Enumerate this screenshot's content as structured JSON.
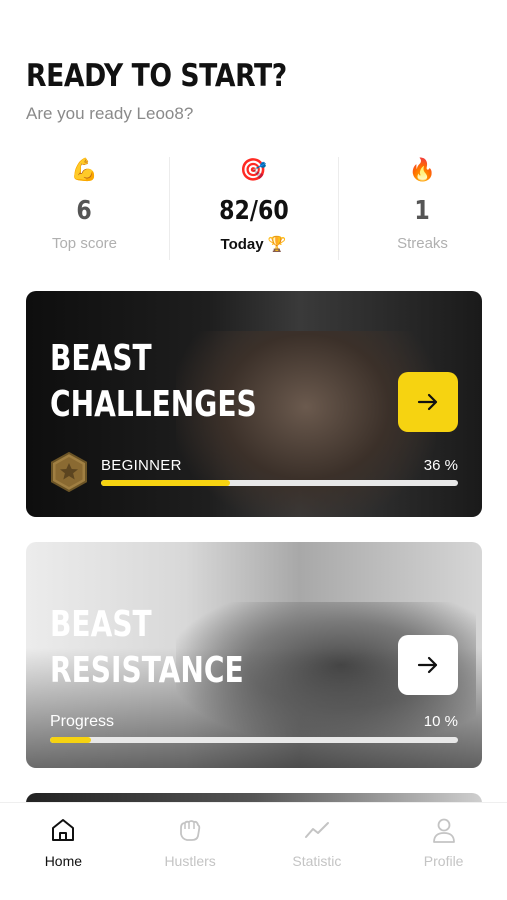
{
  "header": {
    "title": "READY TO START?",
    "subtitle": "Are you ready Leoo8?"
  },
  "stats": [
    {
      "emoji": "💪",
      "icon": "flexed-biceps-icon",
      "value": "6",
      "label": "Top score"
    },
    {
      "emoji": "🎯",
      "icon": "target-icon",
      "value": "82/60",
      "label": "Today 🏆"
    },
    {
      "emoji": "🔥",
      "icon": "fire-icon",
      "value": "1",
      "label": "Streaks"
    }
  ],
  "cards": [
    {
      "title_line1": "BEAST",
      "title_line2": "CHALLENGES",
      "level": "BEGINNER",
      "percent_text": "36 %",
      "progress": 0.36,
      "button_color": "#f6d311"
    },
    {
      "title_line1": "BEAST",
      "title_line2": "RESISTANCE",
      "progress_label": "Progress",
      "percent_text": "10 %",
      "progress": 0.1,
      "button_color": "#ffffff"
    }
  ],
  "tabbar": [
    {
      "label": "Home",
      "icon": "home-icon",
      "active": true
    },
    {
      "label": "Hustlers",
      "icon": "fist-icon",
      "active": false
    },
    {
      "label": "Statistic",
      "icon": "chart-line-icon",
      "active": false
    },
    {
      "label": "Profile",
      "icon": "user-icon",
      "active": false
    }
  ],
  "colors": {
    "accent": "#f6d311",
    "muted": "#b0b0b0"
  }
}
